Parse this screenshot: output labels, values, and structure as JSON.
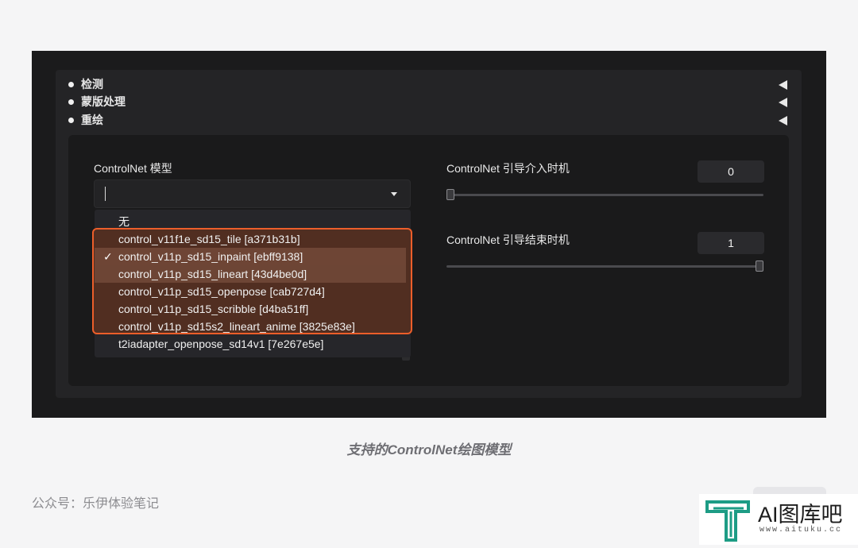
{
  "accordion": {
    "items": [
      {
        "label": "检测"
      },
      {
        "label": "蒙版处理"
      },
      {
        "label": "重绘"
      }
    ]
  },
  "model_select": {
    "label": "ControlNet 模型",
    "current_value": "",
    "options": [
      {
        "label": "无"
      },
      {
        "label": "control_v11f1e_sd15_tile [a371b31b]"
      },
      {
        "label": "control_v11p_sd15_inpaint [ebff9138]",
        "check": "✓",
        "selected": true
      },
      {
        "label": "control_v11p_sd15_lineart [43d4be0d]",
        "hovered": true
      },
      {
        "label": "control_v11p_sd15_openpose [cab727d4]"
      },
      {
        "label": "control_v11p_sd15_scribble [d4ba51ff]"
      },
      {
        "label": "control_v11p_sd15s2_lineart_anime [3825e83e]"
      },
      {
        "label": "t2iadapter_openpose_sd14v1 [7e267e5e]"
      }
    ]
  },
  "guidance_start": {
    "label": "ControlNet 引导介入时机",
    "value": "0",
    "slider_fraction": 0
  },
  "guidance_end": {
    "label": "ControlNet 引导结束时机",
    "value": "1",
    "slider_fraction": 1
  },
  "caption": "支持的ControlNet绘图模型",
  "footer": "公众号：乐伊体验笔记",
  "watermark": {
    "title": "AI图库吧",
    "url": "www.aituku.cc"
  },
  "colors": {
    "highlight_border": "#ec5e2a",
    "highlight_fill": "#512e21",
    "panel": "#242426"
  }
}
